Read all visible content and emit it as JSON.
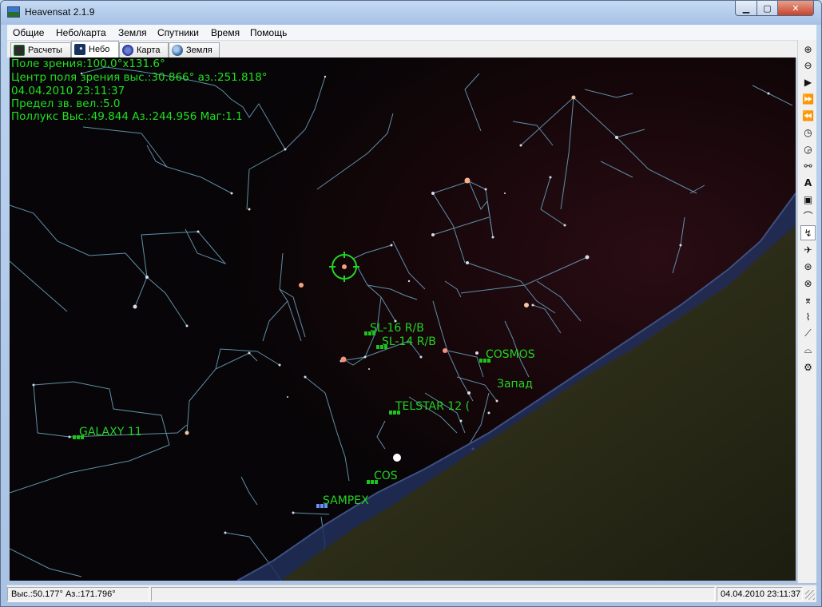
{
  "window": {
    "title": "Heavensat 2.1.9",
    "controls": {
      "minimize": "▁",
      "maximize": "▢",
      "close": "✕"
    }
  },
  "menu": [
    "Общие",
    "Небо/карта",
    "Земля",
    "Спутники",
    "Время",
    "Помощь"
  ],
  "tabs": [
    {
      "label": "Расчеты",
      "icon": "calculator-icon"
    },
    {
      "label": "Небо",
      "icon": "night-sky-icon",
      "active": true
    },
    {
      "label": "Карта",
      "icon": "map-globe-icon"
    },
    {
      "label": "Земля",
      "icon": "earth-icon"
    }
  ],
  "sky": {
    "info": [
      "Поле зрения:100.0°x131.6°",
      "Центр поля зрения выс.:30.866° аз.:251.818°",
      "04.04.2010 23:11:37",
      "Предел зв. вел.:5.0",
      "Поллукс Выс.:49.844 Аз.:244.956 Маг:1.1"
    ],
    "satellites": [
      {
        "name": "SL-16 R/B"
      },
      {
        "name": "SL-14 R/B"
      },
      {
        "name": "COSMOS"
      },
      {
        "name": "TELSTAR 12 ("
      },
      {
        "name": "GALAXY 11"
      },
      {
        "name": "COS"
      },
      {
        "name": "SAMPEX"
      }
    ],
    "direction_label": "Запад",
    "colors": {
      "sky": "#070507",
      "constellation_lines": "#5f8fa8",
      "labels": "#22d422",
      "ground": "#34341e",
      "horizon": "#2a3a66",
      "cursor": "#22d422"
    }
  },
  "toolbar_icons": [
    "zoom-in-icon",
    "zoom-out-icon",
    "play-icon",
    "fast-forward-icon",
    "rewind-icon",
    "clock-icon",
    "clock-alt-icon",
    "binoculars-icon",
    "labels-icon",
    "lock-icon",
    "horizon-arc-icon",
    "trajectory-icon",
    "satellite-icon",
    "sphere-grid-icon",
    "globe-grid-icon",
    "telescope-icon",
    "telescope-alt-icon",
    "line-icon",
    "ground-icon",
    "settings-icon"
  ],
  "status": {
    "coords": "Выс.:50.177° Аз.:171.796°",
    "middle": "",
    "datetime": "04.04.2010 23:11:37"
  }
}
